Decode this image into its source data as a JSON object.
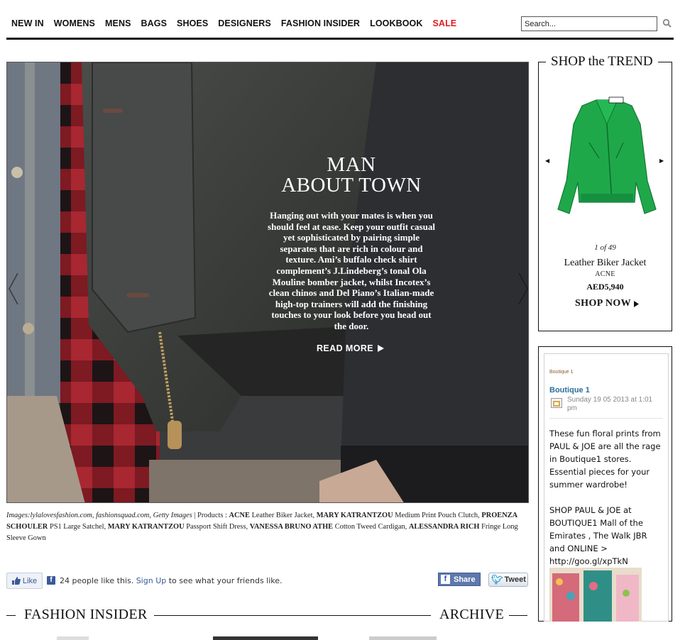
{
  "nav": {
    "items": [
      "NEW IN",
      "WOMENS",
      "MENS",
      "BAGS",
      "SHOES",
      "DESIGNERS",
      "FASHION INSIDER",
      "LOOKBOOK",
      "SALE"
    ],
    "sale_color": "#e01b22"
  },
  "search": {
    "placeholder": "Search...",
    "icon": "magnifier-icon"
  },
  "hero": {
    "title_line1": "MAN",
    "title_line2": "ABOUT TOWN",
    "body": "Hanging out with your mates is when you should feel at ease. Keep your outfit casual yet sophisticated by pairing simple separates that are rich in colour and texture. Ami’s buffalo check shirt complement’s J.Lindeberg’s tonal Ola Mouline bomber jacket, whilst Incotex’s clean chinos and Del Piano’s Italian-made high-top trainers will add the finishing touches to your look before you head out the door.",
    "read_more": "READ MORE"
  },
  "caption": {
    "sources": "Images:lylalovesfashion.com, fashionsquad.com, Getty Images",
    "products_label": "| Products :",
    "items": [
      {
        "brand": "ACNE",
        "product": "Leather Biker Jacket,"
      },
      {
        "brand": "MARY KATRANTZOU",
        "product": "Medium Print Pouch Clutch,"
      },
      {
        "brand": "PROENZA SCHOULER",
        "product": "PS1 Large Satchel,"
      },
      {
        "brand": "MARY KATRANTZOU",
        "product": "Passport Shift Dress,"
      },
      {
        "brand": "VANESSA BRUNO ATHE",
        "product": "Cotton Tweed Cardigan,"
      },
      {
        "brand": "ALESSANDRA RICH",
        "product": "Fringe Long Sleeve Gown"
      }
    ]
  },
  "social": {
    "like_label": "Like",
    "like_count_text": "24 people like this.",
    "signup_label": "Sign Up",
    "signup_suffix": "to see what your friends like.",
    "share_label": "Share",
    "tweet_label": "Tweet"
  },
  "sections": {
    "fashion_insider": "FASHION INSIDER",
    "archive": "ARCHIVE"
  },
  "trend": {
    "title": "SHOP the TREND",
    "counter": "1 of 49",
    "product_name": "Leather Biker Jacket",
    "brand": "ACNE",
    "price": "AED5,940",
    "shop_now": "SHOP NOW",
    "jacket_color": "#1fa84a"
  },
  "facebook": {
    "page_small": "Boutique 1",
    "page_name": "Boutique 1",
    "date": "Sunday 19 05 2013 at 1:01 pm",
    "paragraph1": "These fun floral prints from PAUL & JOE are all the rage in Boutique1 stores. Essential pieces for your summer wardrobe!",
    "paragraph2": "SHOP PAUL & JOE at BOUTIQUE1 Mall of the Emirates , The Walk JBR and ONLINE > http://goo.gl/xpTkN"
  }
}
